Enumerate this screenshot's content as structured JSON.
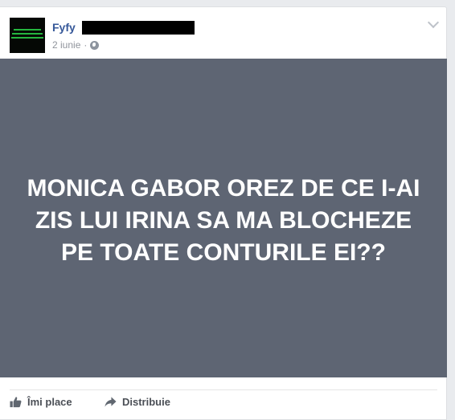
{
  "post": {
    "author_name": "Fyfy",
    "timestamp": "2 iunie",
    "separator": "·",
    "privacy_icon": "globe-icon",
    "status_text": "MONICA GABOR OREZ DE CE I-AI ZIS LUI IRINA SA MA BLOCHEZE PE TOATE CONTURILE EI??"
  },
  "actions": {
    "like_label": "Îmi place",
    "share_label": "Distribuie"
  },
  "colors": {
    "status_background": "#5e6573",
    "author_link": "#365899",
    "page_background": "#e9ebee"
  }
}
